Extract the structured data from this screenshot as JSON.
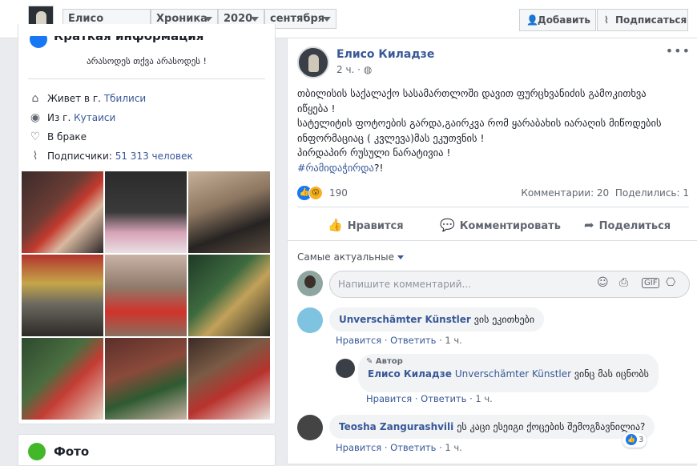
{
  "topbar": {
    "name": "Елисо Киладзе",
    "section": "Хроника",
    "year": "2020",
    "month": "сентября",
    "add_label": "Добавить",
    "subscribe_label": "Подписаться"
  },
  "intro": {
    "title": "Краткая информация",
    "bio": "არასოდეს თქვა არასოდეს !",
    "lives_prefix": "Живет в г.",
    "lives_city": "Тбилиси",
    "from_prefix": "Из г.",
    "from_city": "Кутаиси",
    "relationship": "В браке",
    "followers_prefix": "Подписчики:",
    "followers_count": "51 313 человек"
  },
  "photos_section": {
    "title": "Фото"
  },
  "post": {
    "author": "Елисо Киладзе",
    "time": "2 ч.",
    "text_lines": [
      "თბილისის საქალაქო სასამართლოში დავით ფურცხვანიძის გამოკითხვა",
      "იწყება !",
      "სატელიტის ფოტოების გარდა,გაირკვა რომ ყარაბახის იარაღის მიწოდების",
      "ინფორმაციაც ( კვლევა)მას ეკუთვნის !",
      "პირდაპირ რუსული ნარატივია !"
    ],
    "hashtag": "#რამიდაჭირდა",
    "hashtag_suffix": "?!",
    "reaction_count": "190",
    "comments_count": "Комментарии: 20",
    "shares_count": "Поделились: 1",
    "like_label": "Нравится",
    "comment_label": "Комментировать",
    "share_label": "Поделиться",
    "sort_label": "Самые актуальные",
    "comment_placeholder": "Напишите комментарий..."
  },
  "comments": [
    {
      "name": "Unverschämter Künstler",
      "text": "ვის ეკითხები",
      "like": "Нравится",
      "reply": "Ответить",
      "time": "1 ч."
    },
    {
      "author_tag": "Автор",
      "name": "Елисо Киладзе",
      "mention": "Unverschämter Künstler",
      "text": "ვინც მას იცნობს",
      "like": "Нравится",
      "reply": "Ответить",
      "time": "1 ч."
    },
    {
      "name": "Teosha Zangurashvili",
      "text": "ეს კაცი ესეიგი ქოცების შემოგზავნილია?",
      "like": "Нравится",
      "reply": "Ответить",
      "time": "1 ч.",
      "reactions": "3"
    }
  ],
  "colors": {
    "link": "#385898",
    "brand": "#1877f2"
  }
}
